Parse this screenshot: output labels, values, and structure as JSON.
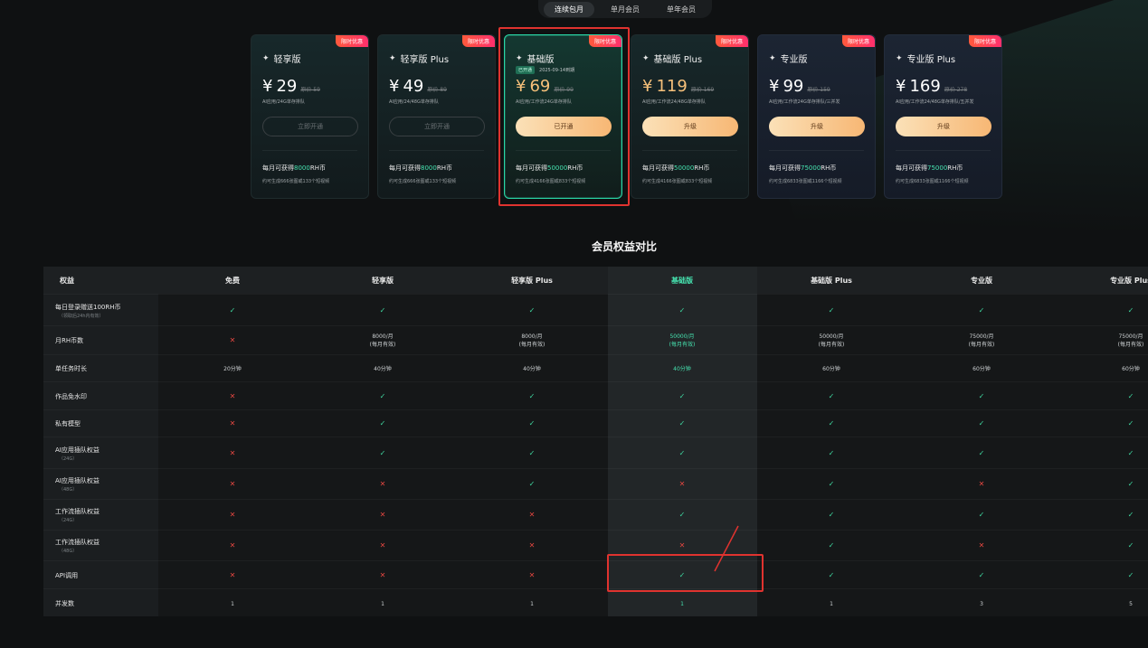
{
  "tabs": [
    {
      "label": "连续包月",
      "active": true
    },
    {
      "label": "单月会员",
      "active": false
    },
    {
      "label": "单年会员",
      "active": false
    }
  ],
  "cards": [
    {
      "title": "轻享版",
      "ribbon": "限时优惠",
      "price": "29",
      "orig": "原价 59",
      "desc": "AI应用/24G单存排队",
      "button": "立即开通",
      "button_style": "ghost",
      "monthly_prefix": "每月可获得",
      "monthly_value": "8000",
      "monthly_suffix": "RH币",
      "gen": "约可生成666张图或133个短视频",
      "badge": "",
      "badge_date": "",
      "theme": "teal",
      "orange": false
    },
    {
      "title": "轻享版 Plus",
      "ribbon": "限时优惠",
      "price": "49",
      "orig": "原价 89",
      "desc": "AI应用/24/48G单存排队",
      "button": "立即开通",
      "button_style": "ghost",
      "monthly_prefix": "每月可获得",
      "monthly_value": "8000",
      "monthly_suffix": "RH币",
      "gen": "约可生成666张图或133个短视频",
      "badge": "",
      "badge_date": "",
      "theme": "teal",
      "orange": false
    },
    {
      "title": "基础版",
      "ribbon": "限时优惠",
      "price": "69",
      "orig": "原价 99",
      "desc": "AI应用/工作流24G单存排队",
      "button": "已开通",
      "button_style": "gold",
      "monthly_prefix": "每月可获得",
      "monthly_value": "50000",
      "monthly_suffix": "RH币",
      "gen": "约可生成4166张图或833个短视频",
      "badge": "已开通",
      "badge_date": "2025-09-14到期",
      "theme": "selected",
      "orange": true
    },
    {
      "title": "基础版 Plus",
      "ribbon": "限时优惠",
      "price": "119",
      "orig": "原价 169",
      "desc": "AI应用/工作流24/48G单存排队",
      "button": "升级",
      "button_style": "gold",
      "monthly_prefix": "每月可获得",
      "monthly_value": "50000",
      "monthly_suffix": "RH币",
      "gen": "约可生成4166张图或833个短视频",
      "badge": "",
      "badge_date": "",
      "theme": "teal",
      "orange": true
    },
    {
      "title": "专业版",
      "ribbon": "限时优惠",
      "price": "99",
      "orig": "原价 159",
      "desc": "AI应用/工作流24G单存排队/三并发",
      "button": "升级",
      "button_style": "gold",
      "monthly_prefix": "每月可获得",
      "monthly_value": "75000",
      "monthly_suffix": "RH币",
      "gen": "约可生成6833张图或1166个短视频",
      "badge": "",
      "badge_date": "",
      "theme": "purple",
      "orange": false
    },
    {
      "title": "专业版 Plus",
      "ribbon": "限时优惠",
      "price": "169",
      "orig": "原价 278",
      "desc": "AI应用/工作流24/48G单存排队/五并发",
      "button": "升级",
      "button_style": "gold",
      "monthly_prefix": "每月可获得",
      "monthly_value": "75000",
      "monthly_suffix": "RH币",
      "gen": "约可生成6833张图或1166个短视频",
      "badge": "",
      "badge_date": "",
      "theme": "purple",
      "orange": false
    }
  ],
  "currency": "¥",
  "section_title": "会员权益对比",
  "table": {
    "headers": [
      "权益",
      "免费",
      "轻享版",
      "轻享版 Plus",
      "基础版",
      "基础版 Plus",
      "专业版",
      "专业版 Plus"
    ],
    "highlight_col": 4,
    "rows": [
      {
        "label": "每日登录赠送100RH币",
        "sub": "（领取后24h内有效）",
        "cells": [
          "ok",
          "ok",
          "ok",
          "ok",
          "ok",
          "ok",
          "ok"
        ]
      },
      {
        "label": "月RH币数",
        "sub": "",
        "cells": [
          "no",
          "8000/月\n(每月有效)",
          "8000/月\n(每月有效)",
          "50000/月\n(每月有效)",
          "50000/月\n(每月有效)",
          "75000/月\n(每月有效)",
          "75000/月\n(每月有效)"
        ]
      },
      {
        "label": "单任务时长",
        "sub": "",
        "cells": [
          "20分钟",
          "40分钟",
          "40分钟",
          "40分钟",
          "60分钟",
          "60分钟",
          "60分钟"
        ]
      },
      {
        "label": "作品免水印",
        "sub": "",
        "cells": [
          "no",
          "ok",
          "ok",
          "ok",
          "ok",
          "ok",
          "ok"
        ]
      },
      {
        "label": "私有模型",
        "sub": "",
        "cells": [
          "no",
          "ok",
          "ok",
          "ok",
          "ok",
          "ok",
          "ok"
        ]
      },
      {
        "label": "AI应用插队权益",
        "sub": "（24G）",
        "cells": [
          "no",
          "ok",
          "ok",
          "ok",
          "ok",
          "ok",
          "ok"
        ]
      },
      {
        "label": "AI应用插队权益",
        "sub": "（48G）",
        "cells": [
          "no",
          "no",
          "ok",
          "no",
          "ok",
          "no",
          "ok"
        ]
      },
      {
        "label": "工作流插队权益",
        "sub": "（24G）",
        "cells": [
          "no",
          "no",
          "no",
          "ok",
          "ok",
          "ok",
          "ok"
        ]
      },
      {
        "label": "工作流插队权益",
        "sub": "（48G）",
        "cells": [
          "no",
          "no",
          "no",
          "no",
          "ok",
          "no",
          "ok"
        ]
      },
      {
        "label": "API调用",
        "sub": "",
        "cells": [
          "no",
          "no",
          "no",
          "ok",
          "ok",
          "ok",
          "ok"
        ]
      },
      {
        "label": "并发数",
        "sub": "",
        "cells": [
          "1",
          "1",
          "1",
          "1",
          "1",
          "3",
          "5"
        ]
      }
    ]
  },
  "symbols": {
    "ok": "✓",
    "no": "✕"
  }
}
